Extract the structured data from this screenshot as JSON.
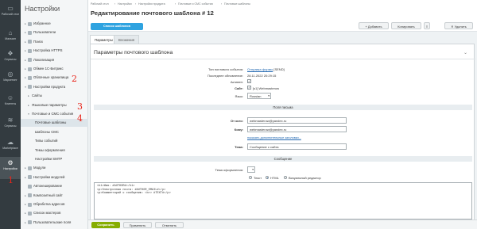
{
  "rail": [
    {
      "icon": "desktop-icon",
      "glyph": "▭",
      "label": "Рабочий стол"
    },
    {
      "icon": "store-icon",
      "glyph": "⌂",
      "label": "Магазин"
    },
    {
      "icon": "services-icon",
      "glyph": "❖",
      "label": "Сервисы"
    },
    {
      "icon": "marketing-icon",
      "glyph": "◎",
      "label": "Маркетинг"
    },
    {
      "icon": "clients-icon",
      "glyph": "☺",
      "label": "Клиенты"
    },
    {
      "icon": "stack-icon",
      "glyph": "≋",
      "label": "Сервисы"
    },
    {
      "icon": "marketplace-icon",
      "glyph": "☁",
      "label": "Marketplace"
    },
    {
      "icon": "settings-gear-icon",
      "glyph": "⚙",
      "label": "Настройки"
    }
  ],
  "sidebar": {
    "title": "Настройки",
    "items": [
      {
        "label": "Избранное",
        "arrow": "▸"
      },
      {
        "label": "Пользователи",
        "arrow": "▸"
      },
      {
        "label": "Поиск",
        "arrow": "▸"
      },
      {
        "label": "Настройка HTTPS",
        "arrow": "▸"
      },
      {
        "label": "Локализация",
        "arrow": "▸"
      },
      {
        "label": "Обмен 1С-Битрикс",
        "arrow": "▸"
      },
      {
        "label": "Облачные хранилища",
        "arrow": "▸"
      },
      {
        "label": "Настройки продукта",
        "arrow": "▾"
      },
      {
        "label": "Сайты",
        "arrow": "▸"
      },
      {
        "label": "Языковые параметры",
        "arrow": "▸"
      },
      {
        "label": "Почтовые и СМС события",
        "arrow": "▾"
      },
      {
        "label": "Почтовые шаблоны",
        "arrow": ""
      },
      {
        "label": "Шаблоны СМС",
        "arrow": ""
      },
      {
        "label": "Типы событий",
        "arrow": ""
      },
      {
        "label": "Темы оформления",
        "arrow": ""
      },
      {
        "label": "Настройки SMTP",
        "arrow": ""
      },
      {
        "label": "Модули",
        "arrow": "▸"
      },
      {
        "label": "Настройки модулей",
        "arrow": "▸"
      },
      {
        "label": "Автокеширование",
        "arrow": ""
      },
      {
        "label": "Композитный сайт",
        "arrow": "▸"
      },
      {
        "label": "Обработка адресов",
        "arrow": "▸"
      },
      {
        "label": "Список мастеров",
        "arrow": "▸"
      },
      {
        "label": "Пользовательские поля",
        "arrow": "▸"
      },
      {
        "label": "CAPTCHA",
        "arrow": "▸"
      }
    ]
  },
  "annotations": [
    "1",
    "2",
    "3",
    "4"
  ],
  "header": {
    "breadcrumbs": [
      "Рабочий стол",
      "Настройки",
      "Настройки продукта",
      "Почтовые и СМС события",
      "Почтовые шаблоны"
    ],
    "breadcrumb_sep": "›",
    "title": "Редактирование почтового шаблона # 12",
    "star": "☆",
    "list_button": "Список шаблонов",
    "add_button": "+ Добавить",
    "copy_button": "Копировать",
    "delete_button": "✕ Удалить",
    "menu_button": "≡"
  },
  "tabs": [
    {
      "label": "Параметры"
    },
    {
      "label": "Вложения"
    }
  ],
  "panel": {
    "title": "Параметры почтового шаблона",
    "collapse": "⌄",
    "event_type_label": "Тип почтового события:",
    "event_type_value": "Отправка формы",
    "event_type_code": "[SEND]",
    "updated_label": "Последнее обновление:",
    "updated_value": "28.11.2022 20:29:15",
    "active_label": "Активен:",
    "site_label": "Сайт:",
    "site_value": "[s1] Webmasterow",
    "lang_label": "Язык:",
    "lang_value": "Russian",
    "letter_fields_header": "Поля письма",
    "from_label": "От кого:",
    "from_value": "webmasterow@yandex.ru",
    "to_label": "Кому:",
    "to_value": "webmasterow@yandex.ru",
    "extra_link": "показать дополнительные заголовки...",
    "subject_label": "Тема:",
    "subject_value": "Сообщение с сайта",
    "message_header": "Сообщение",
    "theme_label": "Тема оформления:",
    "radio_text": "Текст",
    "radio_html": "HTML",
    "radio_visual": "Визуальный редактор",
    "body_lines": [
      "<h1>Имя: #AUTHOR#</h1>",
      "<p>Электронная почта: #AUTHOR_EMAIL#</p>",
      "<p>Комментарий к сообщению: <br> #TEXT#</p>"
    ]
  },
  "footer": {
    "save": "Сохранить",
    "apply": "Применить",
    "cancel": "Отменить"
  }
}
